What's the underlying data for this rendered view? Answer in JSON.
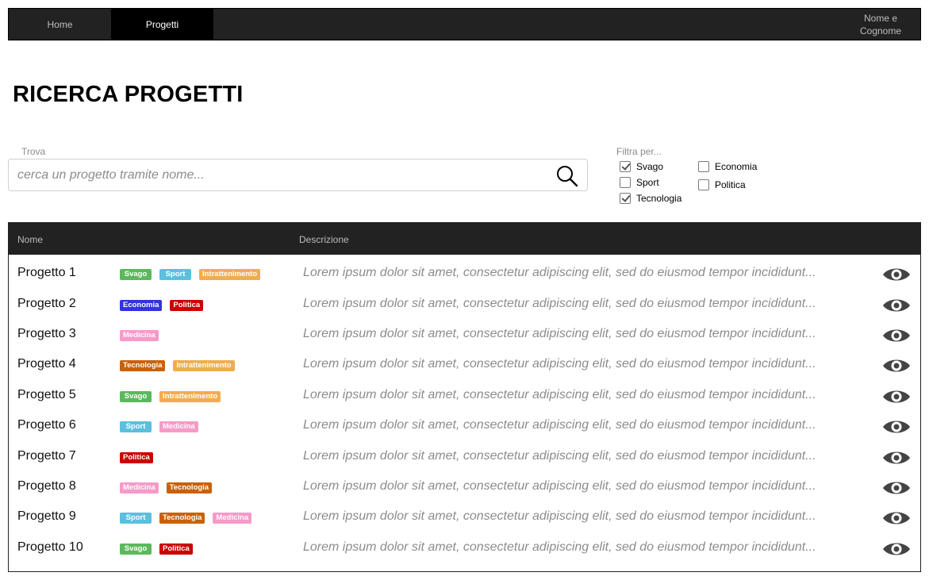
{
  "nav": {
    "home": "Home",
    "projects": "Progetti",
    "user_line1": "Nome e",
    "user_line2": "Cognome"
  },
  "page_title": "RICERCA PROGETTI",
  "search": {
    "label": "Trova",
    "placeholder": "cerca un progetto tramite nome..."
  },
  "filters": {
    "label": "Filtra per...",
    "items": [
      {
        "label": "Svago",
        "checked": true
      },
      {
        "label": "Sport",
        "checked": false
      },
      {
        "label": "Tecnologia",
        "checked": true
      },
      {
        "label": "Economia",
        "checked": false
      },
      {
        "label": "Politica",
        "checked": false
      }
    ]
  },
  "table": {
    "headers": {
      "name": "Nome",
      "description": "Descrizione"
    },
    "rows": [
      {
        "name": "Progetto 1",
        "tags": [
          "Svago",
          "Sport",
          "Intrattenimento"
        ],
        "description": "Lorem ipsum dolor sit amet, consectetur adipiscing elit, sed do eiusmod tempor incididunt..."
      },
      {
        "name": "Progetto 2",
        "tags": [
          "Economia",
          "Politica"
        ],
        "description": "Lorem ipsum dolor sit amet, consectetur adipiscing elit, sed do eiusmod tempor incididunt..."
      },
      {
        "name": "Progetto 3",
        "tags": [
          "Medicina"
        ],
        "description": "Lorem ipsum dolor sit amet, consectetur adipiscing elit, sed do eiusmod tempor incididunt..."
      },
      {
        "name": "Progetto 4",
        "tags": [
          "Tecnologia",
          "Intrattenimento"
        ],
        "description": "Lorem ipsum dolor sit amet, consectetur adipiscing elit, sed do eiusmod tempor incididunt..."
      },
      {
        "name": "Progetto 5",
        "tags": [
          "Svago",
          "Intrattenimento"
        ],
        "description": "Lorem ipsum dolor sit amet, consectetur adipiscing elit, sed do eiusmod tempor incididunt..."
      },
      {
        "name": "Progetto 6",
        "tags": [
          "Sport",
          "Medicina"
        ],
        "description": "Lorem ipsum dolor sit amet, consectetur adipiscing elit, sed do eiusmod tempor incididunt..."
      },
      {
        "name": "Progetto 7",
        "tags": [
          "Politica"
        ],
        "description": "Lorem ipsum dolor sit amet, consectetur adipiscing elit, sed do eiusmod tempor incididunt..."
      },
      {
        "name": "Progetto 8",
        "tags": [
          "Medicina",
          "Tecnologia"
        ],
        "description": "Lorem ipsum dolor sit amet, consectetur adipiscing elit, sed do eiusmod tempor incididunt..."
      },
      {
        "name": "Progetto 9",
        "tags": [
          "Sport",
          "Tecnologia",
          "Medicina"
        ],
        "description": "Lorem ipsum dolor sit amet, consectetur adipiscing elit, sed do eiusmod tempor incididunt..."
      },
      {
        "name": "Progetto 10",
        "tags": [
          "Svago",
          "Politica"
        ],
        "description": "Lorem ipsum dolor sit amet, consectetur adipiscing elit, sed do eiusmod tempor incididunt..."
      }
    ]
  },
  "tag_colors": {
    "Svago": "#5cb85c",
    "Sport": "#5bc0de",
    "Intrattenimento": "#f0ad4e",
    "Economia": "#3333dd",
    "Politica": "#cc0000",
    "Medicina": "#f79ac8",
    "Tecnologia": "#c8620a"
  },
  "icons": {
    "search": "search-icon",
    "view": "eye-icon"
  }
}
